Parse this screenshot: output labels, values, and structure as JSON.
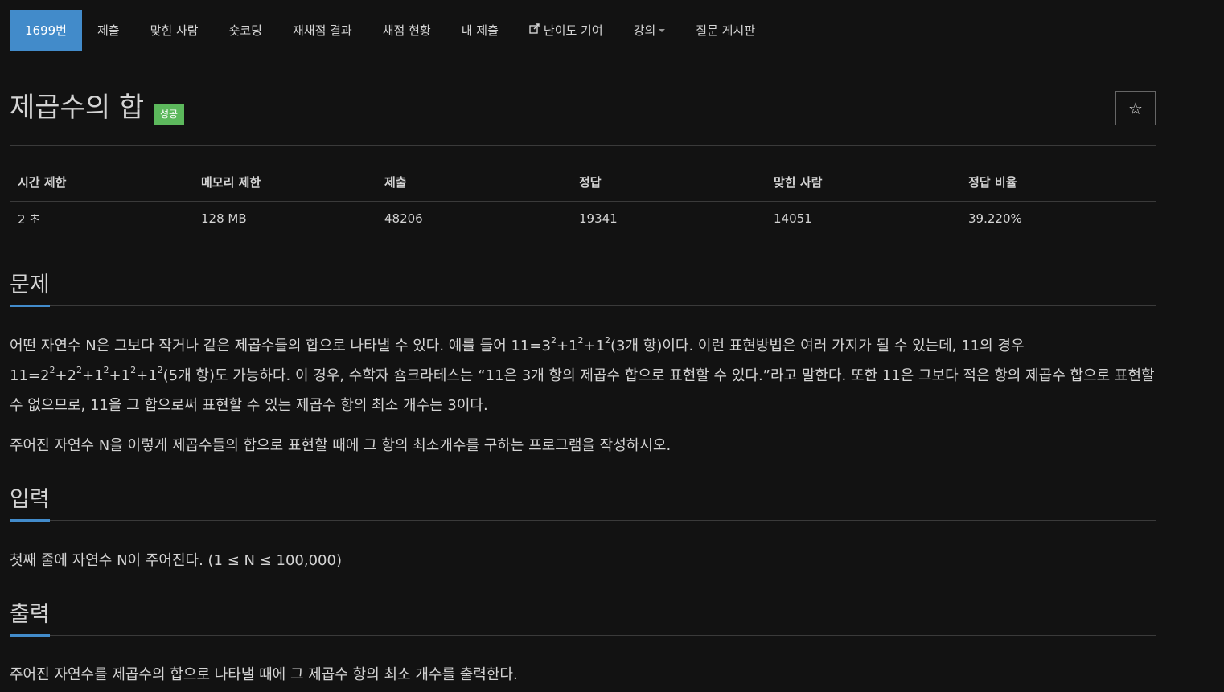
{
  "nav": {
    "items": [
      {
        "label": "1699번",
        "active": true
      },
      {
        "label": "제출"
      },
      {
        "label": "맞힌 사람"
      },
      {
        "label": "숏코딩"
      },
      {
        "label": "재채점 결과"
      },
      {
        "label": "채점 현황"
      },
      {
        "label": "내 제출"
      },
      {
        "label": "난이도 기여",
        "icon": "external-link-icon"
      },
      {
        "label": "강의",
        "dropdown": true
      },
      {
        "label": "질문 게시판"
      }
    ]
  },
  "problem": {
    "title": "제곱수의 합",
    "badge": "성공",
    "star": "☆"
  },
  "info": {
    "headers": [
      "시간 제한",
      "메모리 제한",
      "제출",
      "정답",
      "맞힌 사람",
      "정답 비율"
    ],
    "values": [
      "2 초",
      "128 MB",
      "48206",
      "19341",
      "14051",
      "39.220%"
    ]
  },
  "sections": {
    "problem_heading": "문제",
    "problem_p1": {
      "t1": "어떤 자연수 N은 그보다 작거나 같은 제곱수들의 합으로 나타낼 수 있다. 예를 들어 11=3",
      "s1": "2",
      "t2": "+1",
      "s2": "2",
      "t3": "+1",
      "s3": "2",
      "t4": "(3개 항)이다. 이런 표현방법은 여러 가지가 될 수 있는데, 11의 경우 11=2",
      "s4": "2",
      "t5": "+2",
      "s5": "2",
      "t6": "+1",
      "s6": "2",
      "t7": "+1",
      "s7": "2",
      "t8": "+1",
      "s8": "2",
      "t9": "(5개 항)도 가능하다. 이 경우, 수학자 숌크라테스는 “11은 3개 항의 제곱수 합으로 표현할 수 있다.”라고 말한다. 또한 11은 그보다 적은 항의 제곱수 합으로 표현할 수 없으므로, 11을 그 합으로써 표현할 수 있는 제곱수 항의 최소 개수는 3이다."
    },
    "problem_p2": "주어진 자연수 N을 이렇게 제곱수들의 합으로 표현할 때에 그 항의 최소개수를 구하는 프로그램을 작성하시오.",
    "input_heading": "입력",
    "input_text": "첫째 줄에 자연수 N이 주어진다. (1 ≤ N ≤ 100,000)",
    "output_heading": "출력",
    "output_text": "주어진 자연수를 제곱수의 합으로 나타낼 때에 그 제곱수 항의 최소 개수를 출력한다."
  },
  "colors": {
    "background": "#121212",
    "accent": "#428bca",
    "success": "#5cb85c"
  }
}
